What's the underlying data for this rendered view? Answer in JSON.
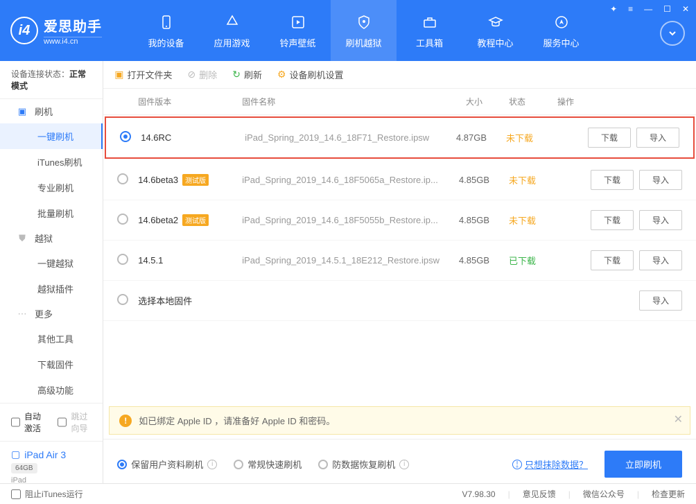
{
  "app": {
    "title_cn": "爱思助手",
    "title_en": "www.i4.cn"
  },
  "window_controls": [
    "✦",
    "☰",
    "—",
    "☐",
    "✕"
  ],
  "nav": [
    {
      "label": "我的设备",
      "icon": "phone"
    },
    {
      "label": "应用游戏",
      "icon": "apps"
    },
    {
      "label": "铃声壁纸",
      "icon": "music"
    },
    {
      "label": "刷机越狱",
      "icon": "shield",
      "active": true
    },
    {
      "label": "工具箱",
      "icon": "toolbox"
    },
    {
      "label": "教程中心",
      "icon": "grad"
    },
    {
      "label": "服务中心",
      "icon": "compass"
    }
  ],
  "sidebar": {
    "status_label": "设备连接状态：",
    "status_value": "正常模式",
    "groups": [
      {
        "icon": "flash",
        "label": "刷机",
        "color": "blue",
        "items": [
          "一键刷机",
          "iTunes刷机",
          "专业刷机",
          "批量刷机"
        ],
        "activeIndex": 0
      },
      {
        "icon": "jail",
        "label": "越狱",
        "color": "gray",
        "items": [
          "一键越狱",
          "越狱插件"
        ]
      },
      {
        "icon": "more",
        "label": "更多",
        "color": "gray",
        "items": [
          "其他工具",
          "下载固件",
          "高级功能"
        ]
      }
    ],
    "auto_activate": "自动激活",
    "skip_wizard": "跳过向导",
    "device": {
      "name": "iPad Air 3",
      "storage": "64GB",
      "type": "iPad"
    }
  },
  "toolbar": {
    "open_folder": "打开文件夹",
    "delete": "删除",
    "refresh": "刷新",
    "settings": "设备刷机设置"
  },
  "columns": {
    "ver": "固件版本",
    "name": "固件名称",
    "size": "大小",
    "status": "状态",
    "action": "操作"
  },
  "firmware": [
    {
      "selected": true,
      "version": "14.6RC",
      "badge": "",
      "filename": "iPad_Spring_2019_14.6_18F71_Restore.ipsw",
      "size": "4.87GB",
      "status": "未下载",
      "status_cls": "nd",
      "download": true,
      "import": true,
      "highlight": true
    },
    {
      "selected": false,
      "version": "14.6beta3",
      "badge": "测试版",
      "filename": "iPad_Spring_2019_14.6_18F5065a_Restore.ip...",
      "size": "4.85GB",
      "status": "未下载",
      "status_cls": "nd",
      "download": true,
      "import": true
    },
    {
      "selected": false,
      "version": "14.6beta2",
      "badge": "测试版",
      "filename": "iPad_Spring_2019_14.6_18F5055b_Restore.ip...",
      "size": "4.85GB",
      "status": "未下载",
      "status_cls": "nd",
      "download": true,
      "import": true
    },
    {
      "selected": false,
      "version": "14.5.1",
      "badge": "",
      "filename": "iPad_Spring_2019_14.5.1_18E212_Restore.ipsw",
      "size": "4.85GB",
      "status": "已下载",
      "status_cls": "dl",
      "download": true,
      "import": true
    },
    {
      "selected": false,
      "version": "选择本地固件",
      "badge": "",
      "filename": "",
      "size": "",
      "status": "",
      "status_cls": "",
      "download": false,
      "import": true
    }
  ],
  "buttons": {
    "download": "下载",
    "import": "导入"
  },
  "warning": "如已绑定 Apple ID ，请准备好 Apple ID 和密码。",
  "flash_options": {
    "opt1": "保留用户资料刷机",
    "opt2": "常规快速刷机",
    "opt3": "防数据恢复刷机",
    "erase_link": "只想抹除数据？",
    "flash_now": "立即刷机"
  },
  "footer": {
    "block_itunes": "阻止iTunes运行",
    "version": "V7.98.30",
    "feedback": "意见反馈",
    "wechat": "微信公众号",
    "update": "检查更新"
  }
}
